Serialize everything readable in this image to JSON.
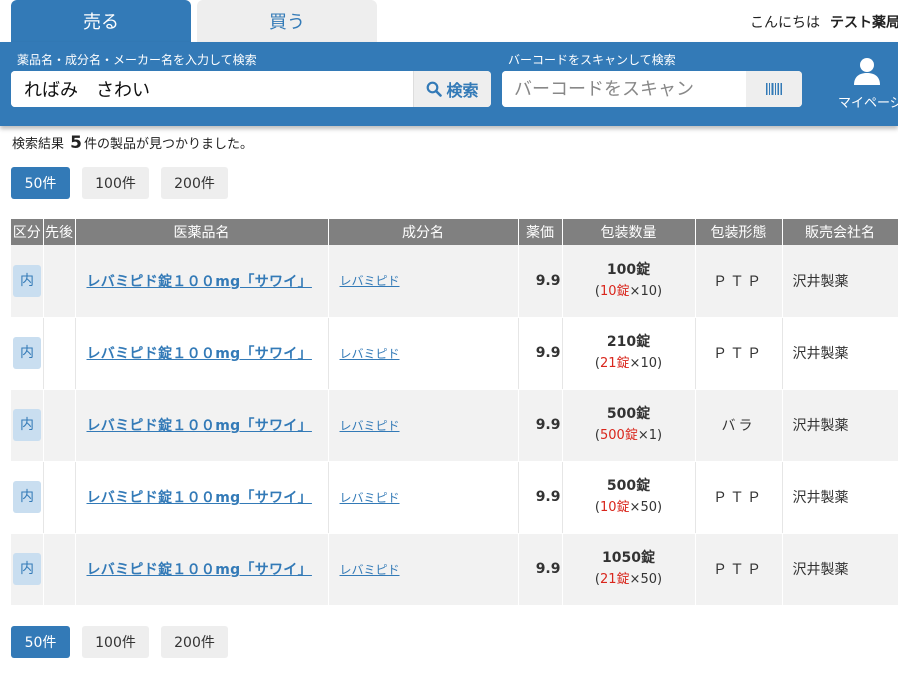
{
  "tabs": {
    "sell": "売る",
    "buy": "買う"
  },
  "user": {
    "greeting": "こんにちは",
    "pharmacy": "テスト薬局"
  },
  "search": {
    "label": "薬品名・成分名・メーカー名を入力して検索",
    "value": "ればみ　さわい",
    "button": "検索"
  },
  "barcode": {
    "label": "バーコードをスキャンして検索",
    "placeholder": "バーコードをスキャン"
  },
  "mypage": {
    "label": "マイページ"
  },
  "summary": {
    "prefix": "検索結果",
    "count": "5",
    "suffix": "件の製品が見つかりました。"
  },
  "perpage": [
    "50件",
    "100件",
    "200件"
  ],
  "table": {
    "headers": [
      "区分",
      "先後",
      "医薬品名",
      "成分名",
      "薬価",
      "包装数量",
      "包装形態",
      "販売会社名"
    ],
    "rows": [
      {
        "category": "内",
        "order": "",
        "name": "レバミピド錠１００mg「サワイ」",
        "ingredient": "レバミピド",
        "price": "9.9",
        "qty_total": "100錠",
        "qty_unit": "10錠",
        "qty_mult": "×10",
        "form": "ＰＴＰ",
        "maker": "沢井製薬"
      },
      {
        "category": "内",
        "order": "",
        "name": "レバミピド錠１００mg「サワイ」",
        "ingredient": "レバミピド",
        "price": "9.9",
        "qty_total": "210錠",
        "qty_unit": "21錠",
        "qty_mult": "×10",
        "form": "ＰＴＰ",
        "maker": "沢井製薬"
      },
      {
        "category": "内",
        "order": "",
        "name": "レバミピド錠１００mg「サワイ」",
        "ingredient": "レバミピド",
        "price": "9.9",
        "qty_total": "500錠",
        "qty_unit": "500錠",
        "qty_mult": "×1",
        "form": "バラ",
        "maker": "沢井製薬"
      },
      {
        "category": "内",
        "order": "",
        "name": "レバミピド錠１００mg「サワイ」",
        "ingredient": "レバミピド",
        "price": "9.9",
        "qty_total": "500錠",
        "qty_unit": "10錠",
        "qty_mult": "×50",
        "form": "ＰＴＰ",
        "maker": "沢井製薬"
      },
      {
        "category": "内",
        "order": "",
        "name": "レバミピド錠１００mg「サワイ」",
        "ingredient": "レバミピド",
        "price": "9.9",
        "qty_total": "1050錠",
        "qty_unit": "21錠",
        "qty_mult": "×50",
        "form": "ＰＴＰ",
        "maker": "沢井製薬"
      }
    ]
  },
  "icons": {
    "search": "search-icon",
    "barcode": "barcode-icon",
    "user": "user-icon"
  },
  "colors": {
    "primary": "#337ab7",
    "header_bg": "#337ab7",
    "table_header": "#808080",
    "qty_highlight": "#d9261c",
    "badge_bg": "#c9def0"
  }
}
